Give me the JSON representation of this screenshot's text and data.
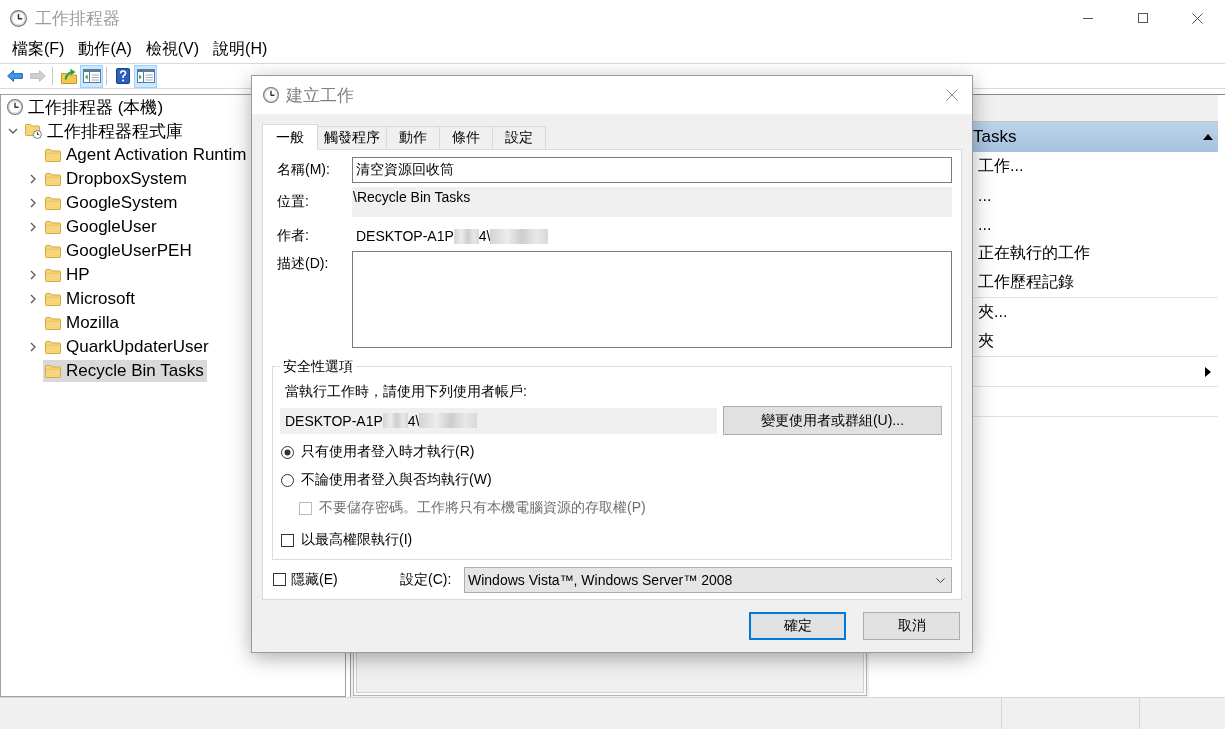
{
  "window": {
    "title": "工作排程器"
  },
  "menu": [
    "檔案(F)",
    "動作(A)",
    "檢視(V)",
    "說明(H)"
  ],
  "toolbar": [
    {
      "kind": "back",
      "pressed": false,
      "disabled": false
    },
    {
      "kind": "forward",
      "pressed": false,
      "disabled": true
    },
    {
      "kind": "separator"
    },
    {
      "kind": "up",
      "pressed": false,
      "disabled": false
    },
    {
      "kind": "console-tree",
      "pressed": true,
      "disabled": false
    },
    {
      "kind": "separator"
    },
    {
      "kind": "help",
      "pressed": false,
      "disabled": false
    },
    {
      "kind": "action-pane",
      "pressed": true,
      "disabled": false
    }
  ],
  "tree": [
    {
      "label": "工作排程器 (本機)",
      "kind": "computer",
      "selected": false,
      "expandable": false,
      "children": [
        {
          "label": "工作排程器程式庫",
          "kind": "library",
          "selected": false,
          "expandable": true,
          "expanded": true,
          "children": [
            {
              "label": "Agent Activation Runtim",
              "kind": "folder",
              "selected": false,
              "expandable": false
            },
            {
              "label": "DropboxSystem",
              "kind": "folder",
              "selected": false,
              "expandable": true,
              "expanded": false
            },
            {
              "label": "GoogleSystem",
              "kind": "folder",
              "selected": false,
              "expandable": true,
              "expanded": false
            },
            {
              "label": "GoogleUser",
              "kind": "folder",
              "selected": false,
              "expandable": true,
              "expanded": false
            },
            {
              "label": "GoogleUserPEH",
              "kind": "folder",
              "selected": false,
              "expandable": false
            },
            {
              "label": "HP",
              "kind": "folder",
              "selected": false,
              "expandable": true,
              "expanded": false
            },
            {
              "label": "Microsoft",
              "kind": "folder",
              "selected": false,
              "expandable": true,
              "expanded": false
            },
            {
              "label": "Mozilla",
              "kind": "folder",
              "selected": false,
              "expandable": false
            },
            {
              "label": "QuarkUpdaterUser",
              "kind": "folder",
              "selected": false,
              "expandable": true,
              "expanded": false
            },
            {
              "label": "Recycle Bin Tasks",
              "kind": "folder",
              "selected": true,
              "expandable": false
            }
          ]
        }
      ]
    }
  ],
  "actions": {
    "section": {
      "title": "Tasks",
      "expanded": true
    },
    "items": [
      {
        "kind": "item",
        "label": "工作...",
        "submenu": false
      },
      {
        "kind": "item",
        "label": "...",
        "submenu": false
      },
      {
        "kind": "item",
        "label": "...",
        "submenu": false
      },
      {
        "kind": "item",
        "label": "正在執行的工作",
        "submenu": false
      },
      {
        "kind": "item",
        "label": "工作歷程記錄",
        "submenu": false
      },
      {
        "kind": "separator"
      },
      {
        "kind": "item",
        "label": "夾...",
        "submenu": false
      },
      {
        "kind": "item",
        "label": "夾",
        "submenu": false
      },
      {
        "kind": "separator"
      },
      {
        "kind": "item",
        "submenu": true
      },
      {
        "kind": "separator"
      },
      {
        "kind": "item",
        "submenu": false
      },
      {
        "kind": "separator"
      }
    ]
  },
  "dialog": {
    "title": "建立工作",
    "tabs": [
      {
        "label": "一般",
        "selected": true
      },
      {
        "label": "觸發程序",
        "selected": false
      },
      {
        "label": "動作",
        "selected": false
      },
      {
        "label": "條件",
        "selected": false
      },
      {
        "label": "設定",
        "selected": false
      }
    ],
    "general": {
      "name": {
        "label": "名稱(M):",
        "value": "清空資源回收筒"
      },
      "location": {
        "label": "位置:",
        "value": "\\Recycle Bin Tasks"
      },
      "author": {
        "label": "作者:",
        "value": [
          {
            "kind": "text",
            "text": "DESKTOP-A1P"
          },
          {
            "kind": "redacted"
          },
          {
            "kind": "text",
            "text": "4\\"
          },
          {
            "kind": "redacted"
          }
        ]
      },
      "description": {
        "label": "描述(D):"
      },
      "security": {
        "title": "安全性選項",
        "prompt": "當執行工作時，請使用下列使用者帳戶:",
        "account": [
          {
            "kind": "text",
            "text": "DESKTOP-A1P"
          },
          {
            "kind": "redacted"
          },
          {
            "kind": "text",
            "text": "4\\"
          },
          {
            "kind": "redacted"
          }
        ],
        "change_button": "變更使用者或群組(U)...",
        "options": [
          {
            "kind": "radio",
            "label": "只有使用者登入時才執行(R)",
            "selected": true
          },
          {
            "kind": "radio",
            "label": "不論使用者登入與否均執行(W)",
            "selected": false,
            "children": [
              {
                "kind": "checkbox",
                "label": "不要儲存密碼。工作將只有本機電腦資源的存取權(P)",
                "checked": false,
                "disabled": true
              }
            ]
          },
          {
            "kind": "checkbox",
            "label": "以最高權限執行(I)",
            "checked": false,
            "disabled": false
          }
        ]
      },
      "hidden": {
        "label": "隱藏(E)",
        "checked": false
      },
      "configure_for": {
        "label": "設定(C):",
        "value": "Windows Vista™, Windows Server™ 2008"
      }
    },
    "buttons": [
      {
        "label": "確定",
        "default": true
      },
      {
        "label": "取消",
        "default": false
      }
    ]
  }
}
